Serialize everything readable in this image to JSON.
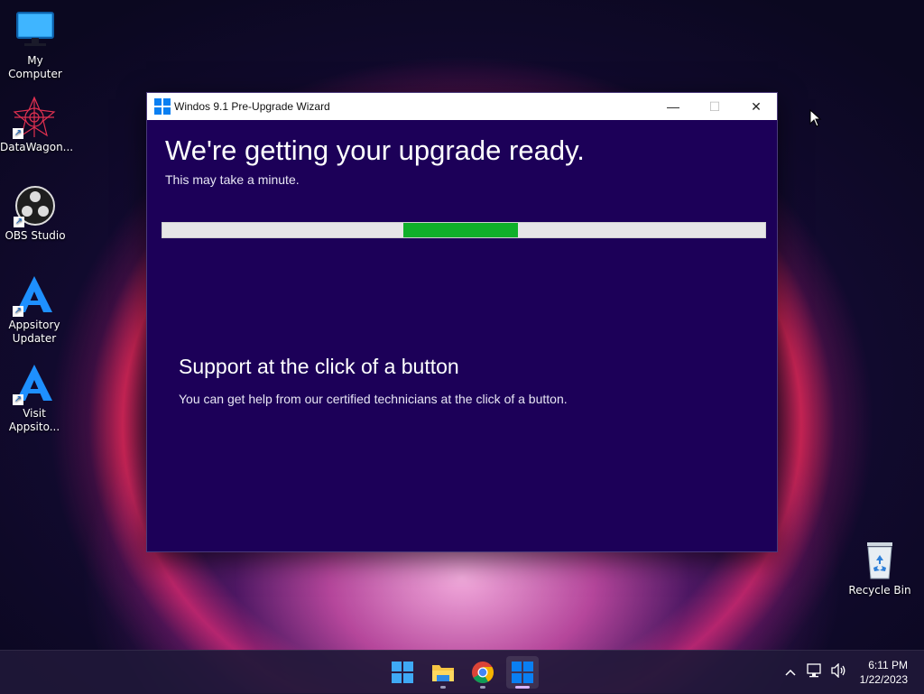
{
  "desktop": {
    "icons": [
      {
        "label_line1": "My Computer",
        "label_line2": ""
      },
      {
        "label_line1": "DataWagon...",
        "label_line2": ""
      },
      {
        "label_line1": "OBS Studio",
        "label_line2": ""
      },
      {
        "label_line1": "Appsitory",
        "label_line2": "Updater"
      },
      {
        "label_line1": "Visit",
        "label_line2": "Appsito..."
      },
      {
        "label_line1": "Recycle Bin",
        "label_line2": ""
      }
    ]
  },
  "window": {
    "title": "Windos 9.1 Pre-Upgrade Wizard",
    "headline": "We're getting your upgrade ready.",
    "subline": "This may take a minute.",
    "progress": {
      "mode": "indeterminate-marquee",
      "chunk_start_fraction": 0.4,
      "chunk_width_fraction": 0.19
    },
    "support_title": "Support at the click of a button",
    "support_text": "You can get help from our certified technicians at the click of a button.",
    "controls": {
      "minimize": "—",
      "maximize": "☐",
      "close": "✕"
    }
  },
  "taskbar": {
    "apps": [
      "start-button",
      "file-explorer",
      "chrome",
      "windows-upgrade-wizard"
    ],
    "clock_time": "6:11 PM",
    "clock_date": "1/22/2023",
    "tray_icons": [
      "chevron-up-icon",
      "network-icon",
      "volume-icon"
    ]
  },
  "colors": {
    "window_bg": "#1c0058",
    "progress_fill": "#10b02a",
    "progress_track": "#e6e6e6",
    "accent_blue": "#0a7ff2"
  }
}
